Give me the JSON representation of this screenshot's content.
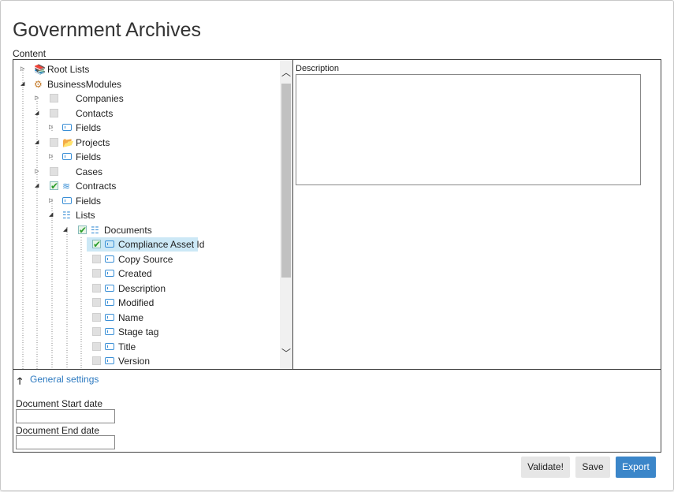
{
  "title": "Government Archives",
  "content_label": "Content",
  "tree": [
    {
      "label": "Root Lists",
      "icon": "root-lists-icon",
      "expander": "▷",
      "check": "none"
    },
    {
      "label": "BusinessModules",
      "icon": "business-modules-icon",
      "expander": "◢",
      "check": "none"
    },
    {
      "label": "Companies",
      "icon": "",
      "expander": "▷",
      "check": "empty"
    },
    {
      "label": "Contacts",
      "icon": "",
      "expander": "◢",
      "check": "empty"
    },
    {
      "label": "Fields",
      "icon": "field-icon",
      "expander": "▷",
      "check": "none"
    },
    {
      "label": "Projects",
      "icon": "projects-icon",
      "expander": "◢",
      "check": "empty"
    },
    {
      "label": "Fields",
      "icon": "field-icon",
      "expander": "▷",
      "check": "none"
    },
    {
      "label": "Cases",
      "icon": "",
      "expander": "▷",
      "check": "empty"
    },
    {
      "label": "Contracts",
      "icon": "contracts-icon",
      "expander": "◢",
      "check": "checked"
    },
    {
      "label": "Fields",
      "icon": "field-icon",
      "expander": "▷",
      "check": "none"
    },
    {
      "label": "Lists",
      "icon": "list-icon",
      "expander": "◢",
      "check": "none"
    },
    {
      "label": "Documents",
      "icon": "list-icon",
      "expander": "◢",
      "check": "checked"
    },
    {
      "label": "Compliance Asset Id",
      "icon": "field-icon",
      "expander": "",
      "check": "checked",
      "selected": true
    },
    {
      "label": "Copy Source",
      "icon": "field-icon",
      "expander": "",
      "check": "empty"
    },
    {
      "label": "Created",
      "icon": "field-icon",
      "expander": "",
      "check": "empty"
    },
    {
      "label": "Description",
      "icon": "field-icon",
      "expander": "",
      "check": "empty"
    },
    {
      "label": "Modified",
      "icon": "field-icon",
      "expander": "",
      "check": "empty"
    },
    {
      "label": "Name",
      "icon": "field-icon",
      "expander": "",
      "check": "empty"
    },
    {
      "label": "Stage tag",
      "icon": "field-icon",
      "expander": "",
      "check": "empty"
    },
    {
      "label": "Title",
      "icon": "field-icon",
      "expander": "",
      "check": "empty"
    },
    {
      "label": "Version",
      "icon": "field-icon",
      "expander": "",
      "check": "empty"
    }
  ],
  "description": {
    "label": "Description",
    "value": ""
  },
  "general_settings": {
    "arrow": "🡑",
    "link": "General settings"
  },
  "fields": {
    "start_label": "Document Start date",
    "start_value": "",
    "end_label": "Document End date",
    "end_value": ""
  },
  "buttons": {
    "validate": "Validate!",
    "save": "Save",
    "export": "Export"
  },
  "colors": {
    "accent": "#3b86c9",
    "selection": "#cce8f6",
    "check": "#2a9d2a"
  }
}
